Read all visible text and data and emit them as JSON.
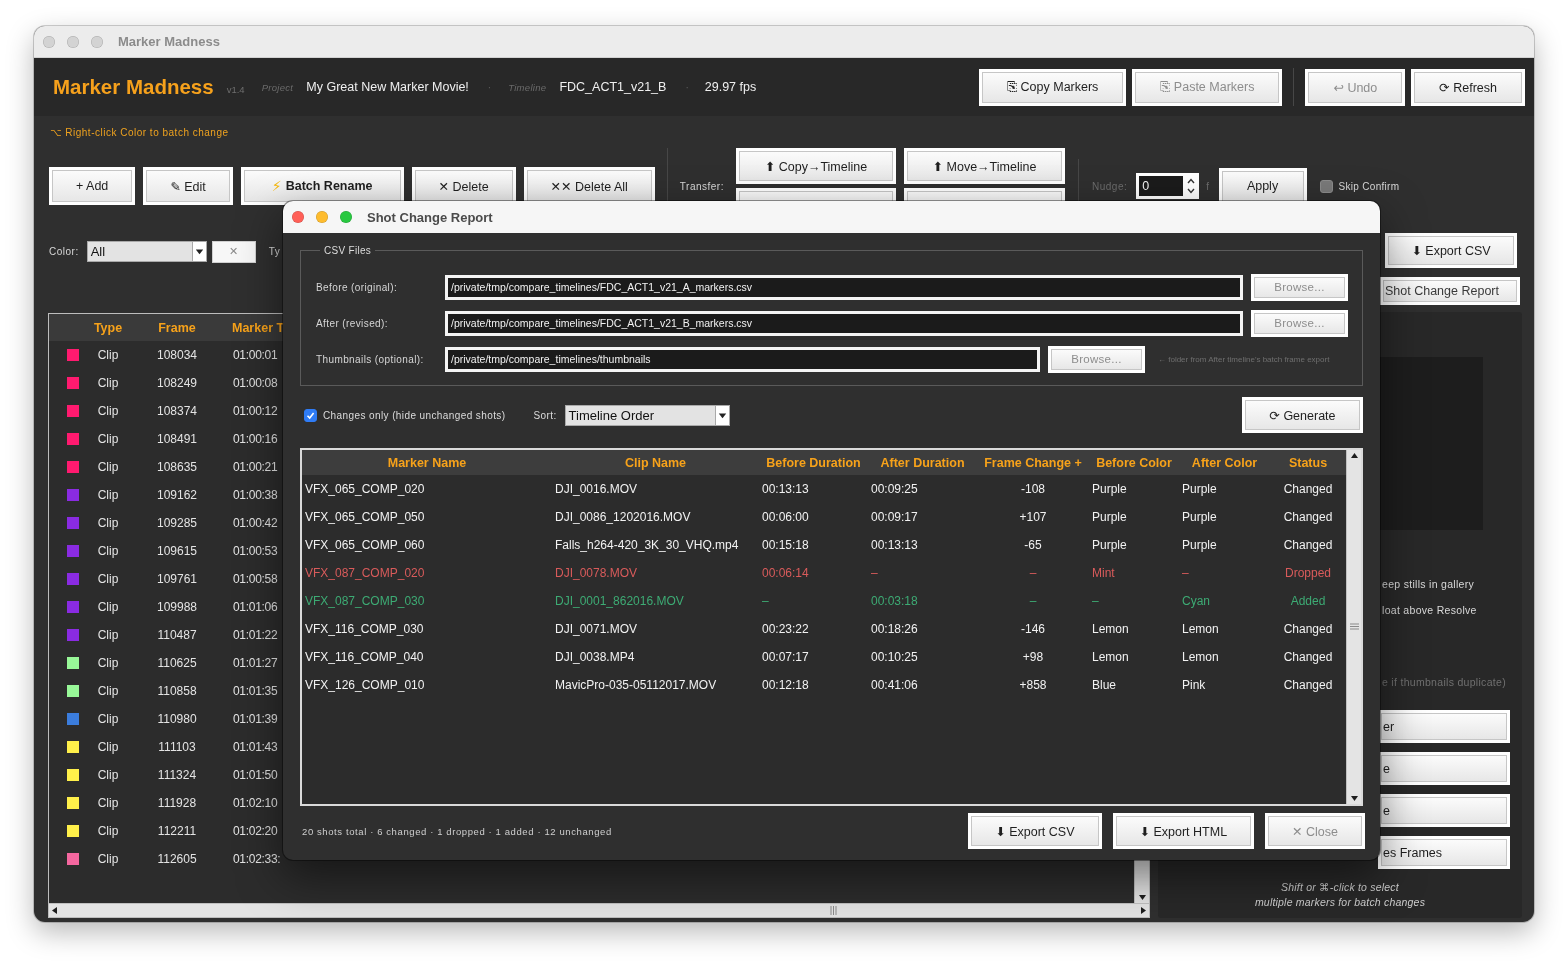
{
  "window": {
    "title": "Marker Madness"
  },
  "header": {
    "app_name": "Marker Madness",
    "version": "v1.4",
    "meta": [
      {
        "label": "Project",
        "value": "My Great New Marker Movie!"
      },
      {
        "separator": "·",
        "label": "Timeline",
        "value": "FDC_ACT1_v21_B"
      },
      {
        "separator": "·",
        "value": "29.97 fps"
      }
    ],
    "buttons": [
      {
        "label": "⎘ Copy Markers",
        "disabled": false
      },
      {
        "label": "⎘ Paste Markers",
        "disabled": true
      },
      {
        "label": "↩ Undo",
        "disabled": true
      },
      {
        "label": "⟳ Refresh",
        "disabled": false
      }
    ]
  },
  "hint": "⌥ Right-click Color to batch change",
  "toolbar": {
    "buttons": [
      {
        "kind": "plain",
        "label": "+ Add"
      },
      {
        "kind": "plain",
        "label": "✎ Edit"
      },
      {
        "kind": "emphasis",
        "icon": "⚡",
        "label": "Batch Rename"
      },
      {
        "kind": "plain",
        "label": "✕ Delete"
      },
      {
        "kind": "plain",
        "label": "✕✕ Delete All"
      }
    ],
    "transfer": {
      "label": "Transfer:",
      "buttons": [
        "⬆ Copy→Timeline",
        "⬆ Move→Timeline"
      ]
    },
    "nudge": {
      "label": "Nudge:",
      "value": "0",
      "unit": "f",
      "apply": "Apply"
    },
    "skip_confirm": {
      "label": "Skip Confirm",
      "checked": false
    }
  },
  "filter": {
    "label": "Color:",
    "value": "All",
    "clear": "✕",
    "next_label": "Ty"
  },
  "marker_table": {
    "columns": [
      "Type",
      "Frame",
      "Marker T"
    ],
    "rows": [
      {
        "color": "#ff1a6f",
        "cells": [
          "Clip",
          "108034",
          "01:00:01"
        ]
      },
      {
        "color": "#ff1a6f",
        "cells": [
          "Clip",
          "108249",
          "01:00:08"
        ]
      },
      {
        "color": "#ff1a6f",
        "cells": [
          "Clip",
          "108374",
          "01:00:12"
        ]
      },
      {
        "color": "#ff1a6f",
        "cells": [
          "Clip",
          "108491",
          "01:00:16"
        ]
      },
      {
        "color": "#ff1a6f",
        "cells": [
          "Clip",
          "108635",
          "01:00:21"
        ]
      },
      {
        "color": "#8a2be2",
        "cells": [
          "Clip",
          "109162",
          "01:00:38"
        ]
      },
      {
        "color": "#8a2be2",
        "cells": [
          "Clip",
          "109285",
          "01:00:42"
        ]
      },
      {
        "color": "#8a2be2",
        "cells": [
          "Clip",
          "109615",
          "01:00:53"
        ]
      },
      {
        "color": "#8a2be2",
        "cells": [
          "Clip",
          "109761",
          "01:00:58"
        ]
      },
      {
        "color": "#8a2be2",
        "cells": [
          "Clip",
          "109988",
          "01:01:06"
        ]
      },
      {
        "color": "#8a2be2",
        "cells": [
          "Clip",
          "110487",
          "01:01:22"
        ]
      },
      {
        "color": "#98f898",
        "cells": [
          "Clip",
          "110625",
          "01:01:27"
        ]
      },
      {
        "color": "#98f898",
        "cells": [
          "Clip",
          "110858",
          "01:01:35"
        ]
      },
      {
        "color": "#3b7ddd",
        "cells": [
          "Clip",
          "110980",
          "01:01:39"
        ]
      },
      {
        "color": "#fff04a",
        "cells": [
          "Clip",
          "111103",
          "01:01:43"
        ]
      },
      {
        "color": "#fff04a",
        "cells": [
          "Clip",
          "111324",
          "01:01:50"
        ]
      },
      {
        "color": "#fff04a",
        "cells": [
          "Clip",
          "111928",
          "01:02:10"
        ]
      },
      {
        "color": "#fff04a",
        "cells": [
          "Clip",
          "112211",
          "01:02:20"
        ]
      },
      {
        "color": "#f4679f",
        "cells": [
          "Clip",
          "112605",
          "01:02:33:"
        ]
      }
    ]
  },
  "side": {
    "export_csv": "⬇ Export CSV",
    "report": "Shot Change Report",
    "panel": {
      "options": [
        "eep stills in gallery",
        "loat above Resolve"
      ],
      "hint": "e if thumbnails duplicate)",
      "buttons": [
        "er",
        "e",
        "e",
        "es Frames"
      ],
      "footer": [
        "Shift or ⌘-click to select",
        "multiple markers for batch changes"
      ]
    }
  },
  "dialog": {
    "title": "Shot Change Report",
    "csv_files": {
      "legend": "CSV Files",
      "rows": [
        {
          "label": "Before (original):",
          "value": "/private/tmp/compare_timelines/FDC_ACT1_v21_A_markers.csv",
          "browse": {
            "label": "Browse...",
            "disabled": true
          }
        },
        {
          "label": "After (revised):",
          "value": "/private/tmp/compare_timelines/FDC_ACT1_v21_B_markers.csv",
          "browse": {
            "label": "Browse...",
            "disabled": true
          }
        },
        {
          "label": "Thumbnails (optional):",
          "value": "/private/tmp/compare_timelines/thumbnails",
          "browse": {
            "label": "Browse...",
            "disabled": true
          },
          "hint": "← folder from After timeline's batch frame export"
        }
      ]
    },
    "changes_only": {
      "label": "Changes only (hide unchanged shots)",
      "checked": true
    },
    "sort": {
      "label": "Sort:",
      "value": "Timeline Order"
    },
    "generate": "⟳ Generate",
    "table": {
      "columns": [
        "Marker Name",
        "Clip Name",
        "Before Duration",
        "After Duration",
        "Frame Change +",
        "Before Color",
        "After Color",
        "Status"
      ],
      "rows": [
        {
          "kind": "changed",
          "cells": [
            "VFX_065_COMP_020",
            "DJI_0016.MOV",
            "00:13:13",
            "00:09:25",
            "-108",
            "Purple",
            "Purple",
            "Changed"
          ]
        },
        {
          "kind": "changed",
          "cells": [
            "VFX_065_COMP_050",
            "DJI_0086_1202016.MOV",
            "00:06:00",
            "00:09:17",
            "+107",
            "Purple",
            "Purple",
            "Changed"
          ]
        },
        {
          "kind": "changed",
          "cells": [
            "VFX_065_COMP_060",
            "Falls_h264-420_3K_30_VHQ.mp4",
            "00:15:18",
            "00:13:13",
            "-65",
            "Purple",
            "Purple",
            "Changed"
          ]
        },
        {
          "kind": "dropped",
          "cells": [
            "VFX_087_COMP_020",
            "DJI_0078.MOV",
            "00:06:14",
            "–",
            "–",
            "Mint",
            "–",
            "Dropped"
          ]
        },
        {
          "kind": "added",
          "cells": [
            "VFX_087_COMP_030",
            "DJI_0001_862016.MOV",
            "–",
            "00:03:18",
            "–",
            "–",
            "Cyan",
            "Added"
          ]
        },
        {
          "kind": "changed",
          "cells": [
            "VFX_116_COMP_030",
            "DJI_0071.MOV",
            "00:23:22",
            "00:18:26",
            "-146",
            "Lemon",
            "Lemon",
            "Changed"
          ]
        },
        {
          "kind": "changed",
          "cells": [
            "VFX_116_COMP_040",
            "DJI_0038.MP4",
            "00:07:17",
            "00:10:25",
            "+98",
            "Lemon",
            "Lemon",
            "Changed"
          ]
        },
        {
          "kind": "changed",
          "cells": [
            "VFX_126_COMP_010",
            "MavicPro-035-05112017.MOV",
            "00:12:18",
            "00:41:06",
            "+858",
            "Blue",
            "Pink",
            "Changed"
          ]
        }
      ]
    },
    "summary": "20 shots total · 6 changed · 1 dropped · 1 added · 12 unchanged",
    "buttons": [
      {
        "label": "⬇ Export CSV",
        "disabled": false
      },
      {
        "label": "⬇ Export HTML",
        "disabled": false
      },
      {
        "label": "✕ Close",
        "disabled": true
      }
    ]
  }
}
